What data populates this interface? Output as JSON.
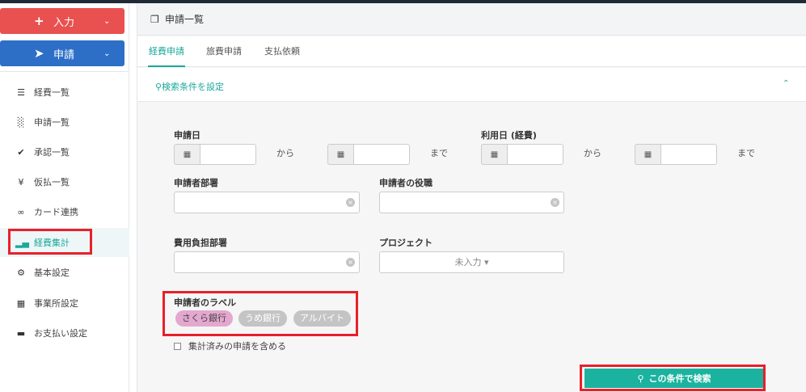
{
  "sidebar": {
    "input_label": "入力",
    "apply_label": "申請",
    "items": [
      {
        "label": "経費一覧",
        "icon": "list-icon"
      },
      {
        "label": "申請一覧",
        "icon": "bar-chart-icon"
      },
      {
        "label": "承認一覧",
        "icon": "check-circle-icon"
      },
      {
        "label": "仮払一覧",
        "icon": "yen-icon"
      },
      {
        "label": "カード連携",
        "icon": "link-icon"
      },
      {
        "label": "経費集計",
        "icon": "signal-icon"
      },
      {
        "label": "基本設定",
        "icon": "gear-icon"
      },
      {
        "label": "事業所設定",
        "icon": "building-icon"
      },
      {
        "label": "お支払い設定",
        "icon": "credit-card-icon"
      }
    ]
  },
  "header": {
    "title": "申請一覧"
  },
  "tabs": [
    "経費申請",
    "旅費申請",
    "支払依頼"
  ],
  "search": {
    "toggle_label": "検索条件を設定",
    "apply_date_label": "申請日",
    "use_date_label": "利用日 (経費)",
    "from": "から",
    "until": "まで",
    "dept_label": "申請者部署",
    "position_label": "申請者の役職",
    "cost_dept_label": "費用負担部署",
    "project_label": "プロジェクト",
    "project_value": "未入力",
    "labels_title": "申請者のラベル",
    "labels": [
      "さくら銀行",
      "うめ銀行",
      "アルバイト"
    ],
    "include_aggregated": "集計済みの申請を含める",
    "submit_label": "この条件で検索"
  },
  "colors": {
    "accent": "#1aa89a",
    "input_btn": "#e8514f",
    "apply_btn": "#2d6fc7",
    "highlight": "#e8202a",
    "tag_pink": "#e4a7cf",
    "tag_gray": "#c4c4c4"
  }
}
